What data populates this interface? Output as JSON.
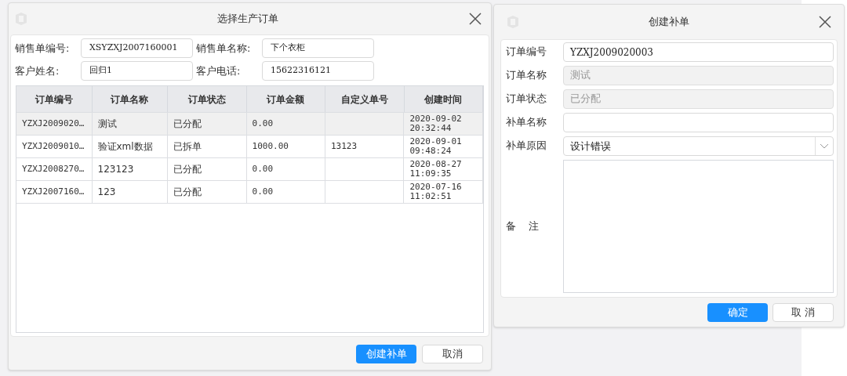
{
  "order_dialog": {
    "title": "选择生产订单",
    "filters": [
      {
        "label": "销售单编号:",
        "value": "XSYZXJ2007160001"
      },
      {
        "label": "销售单名称:",
        "value": "下个衣柜"
      },
      {
        "label": "客户姓名:",
        "value": "回归1"
      },
      {
        "label": "客户电话:",
        "value": "15622316121"
      }
    ],
    "table": {
      "columns": [
        "订单编号",
        "订单名称",
        "订单状态",
        "订单金额",
        "自定义单号",
        "创建时间"
      ],
      "rows": [
        {
          "selected": true,
          "cells": [
            "YZXJ2009020…",
            "测试",
            "已分配",
            "0.00",
            "",
            "2020-09-02\n20:32:44"
          ]
        },
        {
          "selected": false,
          "cells": [
            "YZXJ2009010…",
            "验证xml数据",
            "已拆单",
            "1000.00",
            "13123",
            "2020-09-01\n09:48:24"
          ]
        },
        {
          "selected": false,
          "cells": [
            "YZXJ2008270…",
            "123123",
            "已分配",
            "0.00",
            "",
            "2020-08-27\n11:09:35"
          ]
        },
        {
          "selected": false,
          "cells": [
            "YZXJ2007160…",
            "123",
            "已分配",
            "0.00",
            "",
            "2020-07-16\n11:02:51"
          ]
        }
      ]
    },
    "buttons": [
      {
        "label": "创建补单",
        "kind": "primary"
      },
      {
        "label": "取消",
        "kind": "default"
      }
    ]
  },
  "supplement_dialog": {
    "title": "创建补单",
    "fields": [
      {
        "label": "订单编号",
        "kind": "text",
        "value": "YZXJ2009020003"
      },
      {
        "label": "订单名称",
        "kind": "text",
        "value": "测试",
        "disabled": true
      },
      {
        "label": "订单状态",
        "kind": "text",
        "value": "已分配",
        "disabled": true
      },
      {
        "label": "补单名称",
        "kind": "text"
      },
      {
        "label": "补单原因",
        "kind": "select",
        "value": "设计错误"
      },
      {
        "label": "备 注",
        "kind": "textarea"
      }
    ],
    "buttons": [
      {
        "label": "确定",
        "kind": "primary"
      },
      {
        "label": "取 消",
        "kind": "default"
      }
    ]
  }
}
